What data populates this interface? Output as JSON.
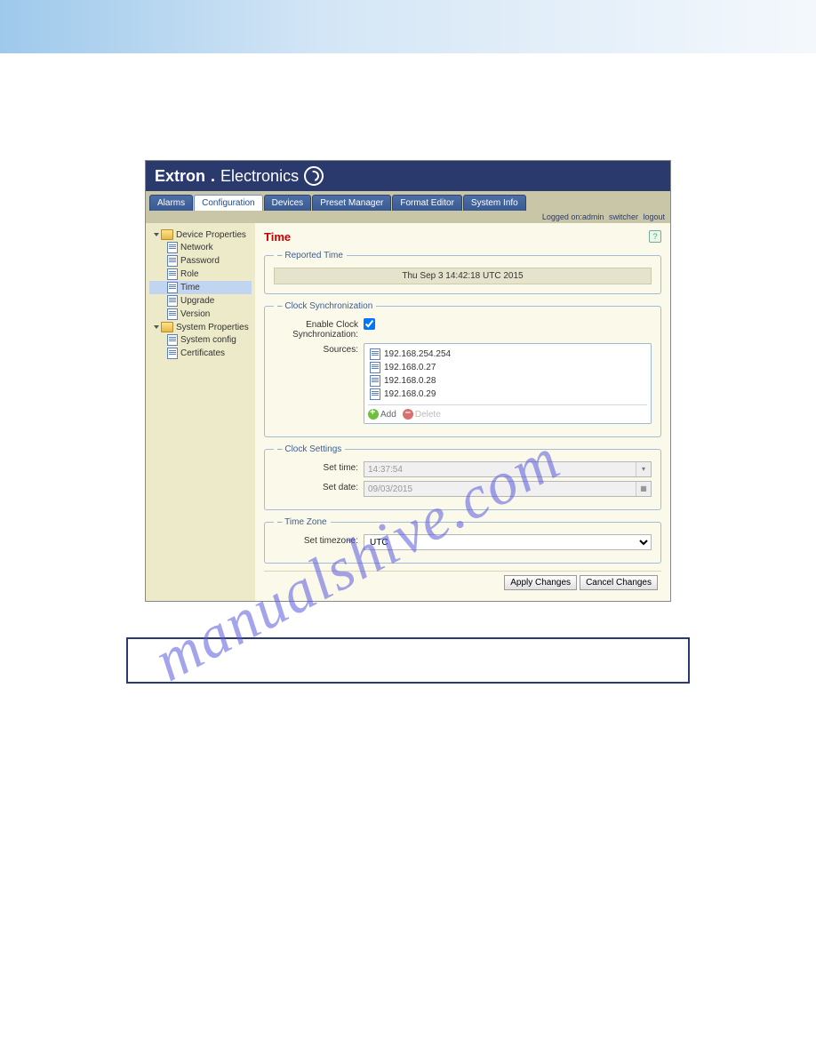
{
  "brand": {
    "part1": "Extron",
    "dot": ".",
    "part2": "Electronics"
  },
  "tabs": {
    "alarms": "Alarms",
    "config": "Configuration",
    "devices": "Devices",
    "preset": "Preset Manager",
    "format": "Format Editor",
    "sys": "System Info"
  },
  "userbar": {
    "logged": "Logged on:",
    "user": "admin",
    "switcher": "switcher",
    "logout": "logout"
  },
  "sidebar": {
    "dev_props": "Device Properties",
    "network": "Network",
    "password": "Password",
    "role": "Role",
    "time": "Time",
    "upgrade": "Upgrade",
    "version": "Version",
    "sys_props": "System Properties",
    "sys_config": "System config",
    "certs": "Certificates"
  },
  "page": {
    "title": "Time",
    "help": "?",
    "reported": {
      "legend": "Reported Time",
      "value": "Thu Sep  3 14:42:18 UTC 2015"
    },
    "sync": {
      "legend": "Clock Synchronization",
      "enable_lbl": "Enable Clock Synchronization:",
      "sources_lbl": "Sources:",
      "sources": [
        "192.168.254.254",
        "192.168.0.27",
        "192.168.0.28",
        "192.168.0.29"
      ],
      "add": "Add",
      "del": "Delete"
    },
    "settings": {
      "legend": "Clock Settings",
      "time_lbl": "Set time:",
      "time_val": "14:37:54",
      "date_lbl": "Set date:",
      "date_val": "09/03/2015"
    },
    "tz": {
      "legend": "Time Zone",
      "lbl": "Set timezone:",
      "val": "UTC"
    },
    "apply": "Apply Changes",
    "cancel": "Cancel Changes"
  },
  "watermark": "manualshive.com"
}
